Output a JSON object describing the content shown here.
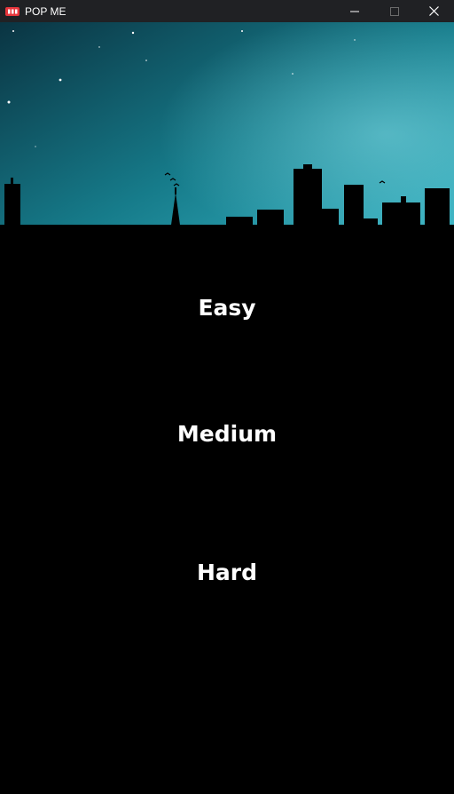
{
  "window": {
    "title": "POP ME",
    "icon": "app-logo-icon",
    "controls": [
      "minimize-icon",
      "maximize-icon",
      "close-icon"
    ]
  },
  "menu": {
    "easy_label": "Easy",
    "medium_label": "Medium",
    "hard_label": "Hard"
  },
  "colors": {
    "background": "#000000",
    "titlebar": "#202124",
    "sky_top": "#0b3846",
    "sky_bottom": "#2aaab8",
    "text": "#ffffff",
    "logo": "#e8363c"
  }
}
